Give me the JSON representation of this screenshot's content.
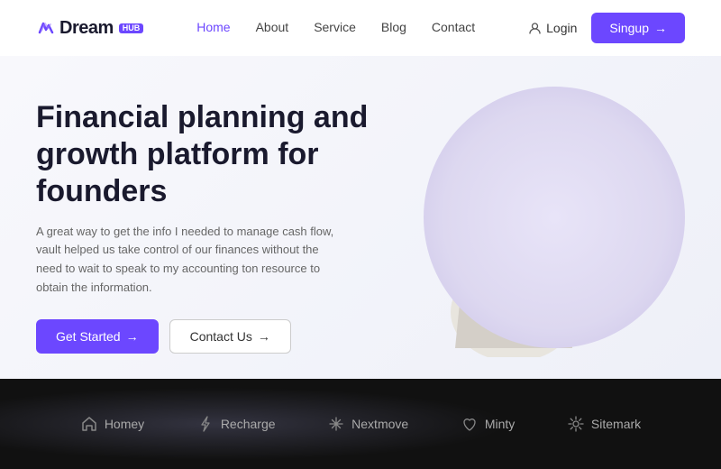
{
  "logo": {
    "text": "Dream",
    "hub_label": "HUB"
  },
  "nav": {
    "links": [
      {
        "label": "Home",
        "active": true
      },
      {
        "label": "About",
        "active": false
      },
      {
        "label": "Service",
        "active": false
      },
      {
        "label": "Blog",
        "active": false
      },
      {
        "label": "Contact",
        "active": false
      }
    ],
    "login_label": "Login",
    "signup_label": "Singup"
  },
  "hero": {
    "title": "Financial planning and growth platform for founders",
    "description": "A great way to get the info I needed to manage cash flow, vault helped us take control of our finances without the need to wait to speak to my accounting ton resource to obtain the information.",
    "cta_primary": "Get Started",
    "cta_secondary": "Contact Us"
  },
  "brands": [
    {
      "name": "Homey",
      "icon": "house"
    },
    {
      "name": "Recharge",
      "icon": "lightning"
    },
    {
      "name": "Nextmove",
      "icon": "asterisk"
    },
    {
      "name": "Minty",
      "icon": "leaf"
    },
    {
      "name": "Sitemark",
      "icon": "gear"
    }
  ]
}
